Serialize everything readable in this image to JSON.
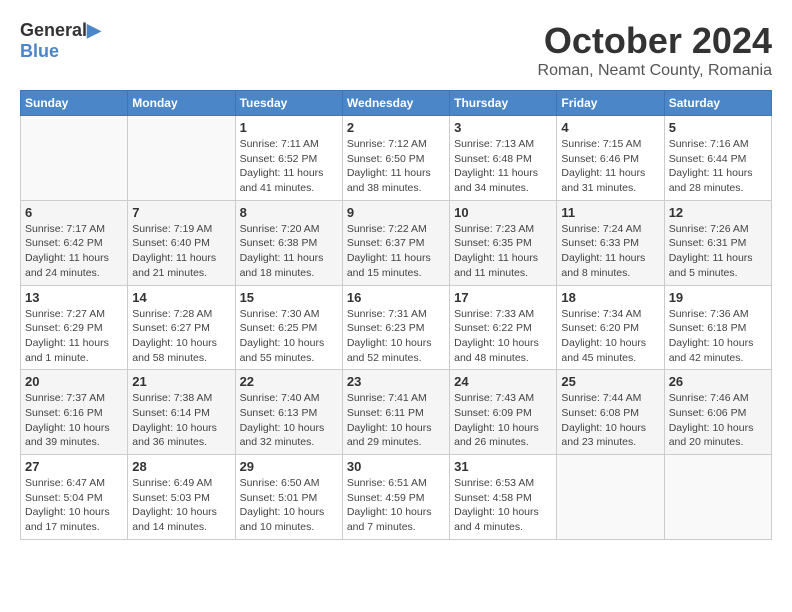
{
  "header": {
    "logo_general": "General",
    "logo_blue": "Blue",
    "month": "October 2024",
    "location": "Roman, Neamt County, Romania"
  },
  "weekdays": [
    "Sunday",
    "Monday",
    "Tuesday",
    "Wednesday",
    "Thursday",
    "Friday",
    "Saturday"
  ],
  "weeks": [
    [
      {
        "day": "",
        "info": ""
      },
      {
        "day": "",
        "info": ""
      },
      {
        "day": "1",
        "info": "Sunrise: 7:11 AM\nSunset: 6:52 PM\nDaylight: 11 hours and 41 minutes."
      },
      {
        "day": "2",
        "info": "Sunrise: 7:12 AM\nSunset: 6:50 PM\nDaylight: 11 hours and 38 minutes."
      },
      {
        "day": "3",
        "info": "Sunrise: 7:13 AM\nSunset: 6:48 PM\nDaylight: 11 hours and 34 minutes."
      },
      {
        "day": "4",
        "info": "Sunrise: 7:15 AM\nSunset: 6:46 PM\nDaylight: 11 hours and 31 minutes."
      },
      {
        "day": "5",
        "info": "Sunrise: 7:16 AM\nSunset: 6:44 PM\nDaylight: 11 hours and 28 minutes."
      }
    ],
    [
      {
        "day": "6",
        "info": "Sunrise: 7:17 AM\nSunset: 6:42 PM\nDaylight: 11 hours and 24 minutes."
      },
      {
        "day": "7",
        "info": "Sunrise: 7:19 AM\nSunset: 6:40 PM\nDaylight: 11 hours and 21 minutes."
      },
      {
        "day": "8",
        "info": "Sunrise: 7:20 AM\nSunset: 6:38 PM\nDaylight: 11 hours and 18 minutes."
      },
      {
        "day": "9",
        "info": "Sunrise: 7:22 AM\nSunset: 6:37 PM\nDaylight: 11 hours and 15 minutes."
      },
      {
        "day": "10",
        "info": "Sunrise: 7:23 AM\nSunset: 6:35 PM\nDaylight: 11 hours and 11 minutes."
      },
      {
        "day": "11",
        "info": "Sunrise: 7:24 AM\nSunset: 6:33 PM\nDaylight: 11 hours and 8 minutes."
      },
      {
        "day": "12",
        "info": "Sunrise: 7:26 AM\nSunset: 6:31 PM\nDaylight: 11 hours and 5 minutes."
      }
    ],
    [
      {
        "day": "13",
        "info": "Sunrise: 7:27 AM\nSunset: 6:29 PM\nDaylight: 11 hours and 1 minute."
      },
      {
        "day": "14",
        "info": "Sunrise: 7:28 AM\nSunset: 6:27 PM\nDaylight: 10 hours and 58 minutes."
      },
      {
        "day": "15",
        "info": "Sunrise: 7:30 AM\nSunset: 6:25 PM\nDaylight: 10 hours and 55 minutes."
      },
      {
        "day": "16",
        "info": "Sunrise: 7:31 AM\nSunset: 6:23 PM\nDaylight: 10 hours and 52 minutes."
      },
      {
        "day": "17",
        "info": "Sunrise: 7:33 AM\nSunset: 6:22 PM\nDaylight: 10 hours and 48 minutes."
      },
      {
        "day": "18",
        "info": "Sunrise: 7:34 AM\nSunset: 6:20 PM\nDaylight: 10 hours and 45 minutes."
      },
      {
        "day": "19",
        "info": "Sunrise: 7:36 AM\nSunset: 6:18 PM\nDaylight: 10 hours and 42 minutes."
      }
    ],
    [
      {
        "day": "20",
        "info": "Sunrise: 7:37 AM\nSunset: 6:16 PM\nDaylight: 10 hours and 39 minutes."
      },
      {
        "day": "21",
        "info": "Sunrise: 7:38 AM\nSunset: 6:14 PM\nDaylight: 10 hours and 36 minutes."
      },
      {
        "day": "22",
        "info": "Sunrise: 7:40 AM\nSunset: 6:13 PM\nDaylight: 10 hours and 32 minutes."
      },
      {
        "day": "23",
        "info": "Sunrise: 7:41 AM\nSunset: 6:11 PM\nDaylight: 10 hours and 29 minutes."
      },
      {
        "day": "24",
        "info": "Sunrise: 7:43 AM\nSunset: 6:09 PM\nDaylight: 10 hours and 26 minutes."
      },
      {
        "day": "25",
        "info": "Sunrise: 7:44 AM\nSunset: 6:08 PM\nDaylight: 10 hours and 23 minutes."
      },
      {
        "day": "26",
        "info": "Sunrise: 7:46 AM\nSunset: 6:06 PM\nDaylight: 10 hours and 20 minutes."
      }
    ],
    [
      {
        "day": "27",
        "info": "Sunrise: 6:47 AM\nSunset: 5:04 PM\nDaylight: 10 hours and 17 minutes."
      },
      {
        "day": "28",
        "info": "Sunrise: 6:49 AM\nSunset: 5:03 PM\nDaylight: 10 hours and 14 minutes."
      },
      {
        "day": "29",
        "info": "Sunrise: 6:50 AM\nSunset: 5:01 PM\nDaylight: 10 hours and 10 minutes."
      },
      {
        "day": "30",
        "info": "Sunrise: 6:51 AM\nSunset: 4:59 PM\nDaylight: 10 hours and 7 minutes."
      },
      {
        "day": "31",
        "info": "Sunrise: 6:53 AM\nSunset: 4:58 PM\nDaylight: 10 hours and 4 minutes."
      },
      {
        "day": "",
        "info": ""
      },
      {
        "day": "",
        "info": ""
      }
    ]
  ]
}
